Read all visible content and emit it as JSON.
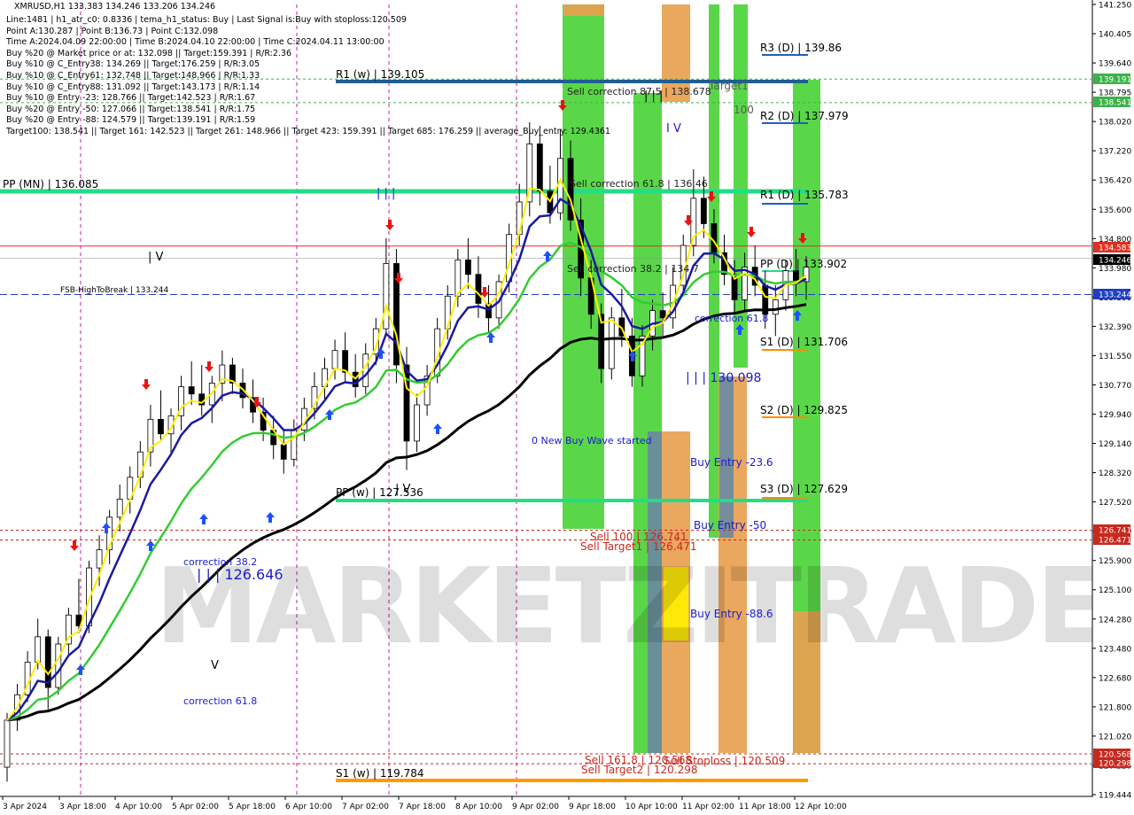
{
  "window": {
    "title": "XMRUSD,H1  133.383 134.246 133.206 134.246"
  },
  "info_lines": [
    "Line:1481 | h1_atr_c0: 0.8336 | tema_h1_status: Buy | Last Signal is:Buy with stoploss:120.509",
    "Point A:130.287 | Point B:136.73 | Point C:132.098",
    "Time A:2024.04.09 22:00:00 | Time B:2024.04.10 22:00:00 | Time C:2024.04.11 13:00:00",
    "Buy %20 @ Market price or at: 132.098 || Target:159.391 | R/R:2.36",
    "Buy %10 @ C_Entry38: 134.269 || Target:176.259 | R/R:3.05",
    "Buy %10 @ C_Entry61: 132.748 || Target:148.966 | R/R:1.33",
    "Buy %10 @ C_Entry88: 131.092 || Target:143.173 | R/R:1.14",
    "Buy %10 @ Entry -23: 128.766 || Target:142.523 | R/R:1.67",
    "Buy %20 @ Entry -50: 127.066 || Target:138.541 | R/R:1.75",
    "Buy %20 @ Entry -88: 124.579 || Target:139.191 | R/R:1.59",
    "Target100: 138.541 || Target 161: 142.523 || Target 261: 148.966 || Target 423: 159.391 || Target 685: 176.259 || average_Buy_entry: 129.4361"
  ],
  "chart_data": {
    "type": "candlestick",
    "symbol": "XMRUSD",
    "timeframe": "H1",
    "y_axis": {
      "min": 119.444,
      "max": 141.25,
      "ticks": [
        "141.250",
        "140.405",
        "139.640",
        "138.795",
        "138.020",
        "137.220",
        "136.420",
        "135.600",
        "134.800",
        "133.980",
        "133.160",
        "132.390",
        "131.550",
        "130.770",
        "129.940",
        "129.140",
        "128.320",
        "127.520",
        "126.730",
        "125.900",
        "125.100",
        "124.280",
        "123.480",
        "122.680",
        "121.800",
        "121.020",
        "120.220",
        "119.444"
      ],
      "tick_values": [
        141.25,
        140.405,
        139.64,
        138.795,
        138.02,
        137.22,
        136.42,
        135.6,
        134.8,
        133.98,
        133.16,
        132.39,
        131.55,
        130.77,
        129.94,
        129.14,
        128.32,
        127.52,
        126.73,
        125.9,
        125.1,
        124.28,
        123.48,
        122.68,
        121.8,
        121.02,
        120.22,
        119.444
      ]
    },
    "x_axis": {
      "labels": [
        "3 Apr 2024",
        "3 Apr 18:00",
        "4 Apr 10:00",
        "5 Apr 02:00",
        "5 Apr 18:00",
        "6 Apr 10:00",
        "7 Apr 02:00",
        "7 Apr 18:00",
        "8 Apr 10:00",
        "9 Apr 02:00",
        "9 Apr 18:00",
        "10 Apr 10:00",
        "11 Apr 02:00",
        "11 Apr 18:00",
        "12 Apr 10:00"
      ]
    },
    "price_tags": [
      {
        "value": 139.191,
        "label": "139.191",
        "bg": "#3cb34a",
        "color": "#ffffff"
      },
      {
        "value": 138.541,
        "label": "138.541",
        "bg": "#3cb34a",
        "color": "#ffffff"
      },
      {
        "value": 134.583,
        "label": "134.583",
        "bg": "#e03020",
        "color": "#ffffff"
      },
      {
        "value": 134.246,
        "label": "134.246",
        "bg": "#000000",
        "color": "#ffffff"
      },
      {
        "value": 133.244,
        "label": "133.244",
        "bg": "#1f3fbf",
        "color": "#ffffff"
      },
      {
        "value": 126.741,
        "label": "126.741",
        "bg": "#c8281e",
        "color": "#ffffff"
      },
      {
        "value": 126.471,
        "label": "126.471",
        "bg": "#c8281e",
        "color": "#ffffff"
      },
      {
        "value": 120.568,
        "label": "120.568",
        "bg": "#c8281e",
        "color": "#ffffff"
      },
      {
        "value": 120.298,
        "label": "120.298",
        "bg": "#c8281e",
        "color": "#ffffff"
      }
    ],
    "levels": [
      {
        "label": "R3 (D) | 139.86",
        "value": 139.86,
        "color": "#1f5fbf"
      },
      {
        "label": "R1 (w) | 139.105",
        "value": 139.105,
        "color": "#1f5f8f"
      },
      {
        "label": "R2 (D) | 137.979",
        "value": 137.979,
        "color": "#1f5fbf"
      },
      {
        "label": "PP (MN) | 136.085",
        "value": 136.085,
        "color": "#22dd88"
      },
      {
        "label": "R1 (D) | 135.783",
        "value": 135.783,
        "color": "#1f5fbf"
      },
      {
        "label": "PP (D) | 133.902",
        "value": 133.902,
        "color": "#22dd88"
      },
      {
        "label": "FSB-HighToBreak | 133.244",
        "value": 133.244,
        "color": "#1f3fbf"
      },
      {
        "label": "S1 (D) | 131.706",
        "value": 131.706,
        "color": "#ff8c00"
      },
      {
        "label": "S2 (D) | 129.825",
        "value": 129.825,
        "color": "#ff8c00"
      },
      {
        "label": "PP (w) | 127.536",
        "value": 127.536,
        "color": "#22dd88"
      },
      {
        "label": "S3 (D) | 127.629",
        "value": 127.629,
        "color": "#ff8c00"
      },
      {
        "label": "S1 (w) | 119.784",
        "value": 119.784,
        "color": "#ff9900"
      }
    ],
    "annotations": [
      "Sell correction 87.5 | 138.678",
      "Sell correction 61.8 | 136.46",
      "Sell correction 38.2 | 134.7",
      "correction 38.2",
      "correction 61.8",
      "correction 61.8",
      "| | | 126.646",
      "| | | 130.098",
      "0 New Buy Wave started",
      "Buy Entry -23.6",
      "Buy Entry -50",
      "Buy Entry -88.6",
      "Sell 100 | 126.741",
      "Sell Target1 | 126.471",
      "Sell 161.8 | 120.568",
      "Sell Target2 | 120.298",
      "Sell Stoploss | 120.509",
      "Target1",
      "100",
      "| V",
      "V",
      "| | |",
      "| | |",
      "| V",
      "I V"
    ],
    "watermark": "MARKETZITRADE",
    "series": {
      "candles": [
        [
          120.2,
          121.7,
          119.8,
          121.5
        ],
        [
          121.5,
          122.5,
          121.2,
          122.2
        ],
        [
          122.2,
          123.4,
          122,
          123.1
        ],
        [
          123.1,
          124.3,
          122.9,
          123.8
        ],
        [
          123.8,
          124,
          121.8,
          122.4
        ],
        [
          122.4,
          123.8,
          122.2,
          123.6
        ],
        [
          123.6,
          124.6,
          123.3,
          124.4
        ],
        [
          124.4,
          125.4,
          123.9,
          124.1
        ],
        [
          124.1,
          125.9,
          123.9,
          125.7
        ],
        [
          125.7,
          126.6,
          125.2,
          126.2
        ],
        [
          126.2,
          127.3,
          125.8,
          127.1
        ],
        [
          127.1,
          128,
          126.7,
          127.6
        ],
        [
          127.6,
          128.5,
          127.2,
          128.2
        ],
        [
          128.2,
          129.2,
          127.9,
          128.9
        ],
        [
          128.9,
          130.2,
          128.5,
          129.8
        ],
        [
          129.8,
          130.6,
          129.2,
          129.4
        ],
        [
          129.4,
          130.1,
          128.8,
          129.9
        ],
        [
          129.9,
          131,
          129.5,
          130.7
        ],
        [
          130.7,
          131.4,
          130.2,
          130.5
        ],
        [
          130.5,
          131.3,
          129.9,
          130.2
        ],
        [
          130.2,
          131,
          129.7,
          130.8
        ],
        [
          130.8,
          131.7,
          130.3,
          131.3
        ],
        [
          131.3,
          131.5,
          130.5,
          130.8
        ],
        [
          130.8,
          131.2,
          130.1,
          130.4
        ],
        [
          130.4,
          130.9,
          129.7,
          130
        ],
        [
          130,
          130.4,
          129.2,
          129.5
        ],
        [
          129.5,
          129.9,
          128.7,
          129.1
        ],
        [
          129.1,
          129.5,
          128.3,
          128.7
        ],
        [
          128.7,
          129.8,
          128.5,
          129.5
        ],
        [
          129.5,
          130.4,
          129.2,
          130.1
        ],
        [
          130.1,
          131.1,
          129.8,
          130.7
        ],
        [
          130.7,
          131.5,
          130.3,
          131.2
        ],
        [
          131.2,
          132,
          130.9,
          131.7
        ],
        [
          131.7,
          132.2,
          130.8,
          131.1
        ],
        [
          131.1,
          131.6,
          130.4,
          130.7
        ],
        [
          130.7,
          131.9,
          130.5,
          131.6
        ],
        [
          131.6,
          132.6,
          131.3,
          132.3
        ],
        [
          132.3,
          134.8,
          132.1,
          134.1
        ],
        [
          134.1,
          134.5,
          130.8,
          131.3
        ],
        [
          131.3,
          131.8,
          128.4,
          129.2
        ],
        [
          129.2,
          130.5,
          128.9,
          130.2
        ],
        [
          130.2,
          131.3,
          129.9,
          131
        ],
        [
          131,
          132.6,
          130.8,
          132.3
        ],
        [
          132.3,
          133.5,
          132,
          133.2
        ],
        [
          133.2,
          134.5,
          132.9,
          134.2
        ],
        [
          134.2,
          134.8,
          133.4,
          133.8
        ],
        [
          133.8,
          134.3,
          132.6,
          133
        ],
        [
          133,
          133.5,
          132.2,
          132.6
        ],
        [
          132.6,
          133.8,
          132.3,
          133.6
        ],
        [
          133.6,
          135.2,
          133.3,
          134.9
        ],
        [
          134.9,
          136.3,
          134.6,
          135.8
        ],
        [
          135.8,
          138,
          135.4,
          137.4
        ],
        [
          137.4,
          137.9,
          135.7,
          136.1
        ],
        [
          136.1,
          136.8,
          135.2,
          135.5
        ],
        [
          135.5,
          137.8,
          135.3,
          137
        ],
        [
          137,
          137.5,
          135,
          135.3
        ],
        [
          135.3,
          135.9,
          133.2,
          133.7
        ],
        [
          133.7,
          134.2,
          132.3,
          132.7
        ],
        [
          132.7,
          133,
          130.8,
          131.2
        ],
        [
          131.2,
          132.9,
          130.9,
          132.6
        ],
        [
          132.6,
          133.4,
          131.8,
          132.1
        ],
        [
          132.1,
          132.6,
          130.7,
          131
        ],
        [
          131,
          132.4,
          130.7,
          132.1
        ],
        [
          132.1,
          133.1,
          131.7,
          132.8
        ],
        [
          132.8,
          133.3,
          132.1,
          132.6
        ],
        [
          132.6,
          134,
          132.3,
          133.5
        ],
        [
          133.5,
          134.9,
          133.2,
          134.6
        ],
        [
          134.6,
          136.7,
          134.3,
          135.9
        ],
        [
          135.9,
          136.5,
          134.8,
          135.2
        ],
        [
          135.2,
          135.6,
          134.1,
          134.4
        ],
        [
          134.4,
          134.9,
          133.5,
          133.8
        ],
        [
          133.8,
          134.2,
          132.7,
          133.1
        ],
        [
          133.1,
          134.4,
          132.8,
          134
        ],
        [
          134,
          134.6,
          133.2,
          133.5
        ],
        [
          133.5,
          133.9,
          132.3,
          132.7
        ],
        [
          132.7,
          133.5,
          132.1,
          133.1
        ],
        [
          133.1,
          134.2,
          132.8,
          133.9
        ],
        [
          133.9,
          134.5,
          133.2,
          133.6
        ],
        [
          133.6,
          134.3,
          133.1,
          134
        ]
      ]
    }
  }
}
